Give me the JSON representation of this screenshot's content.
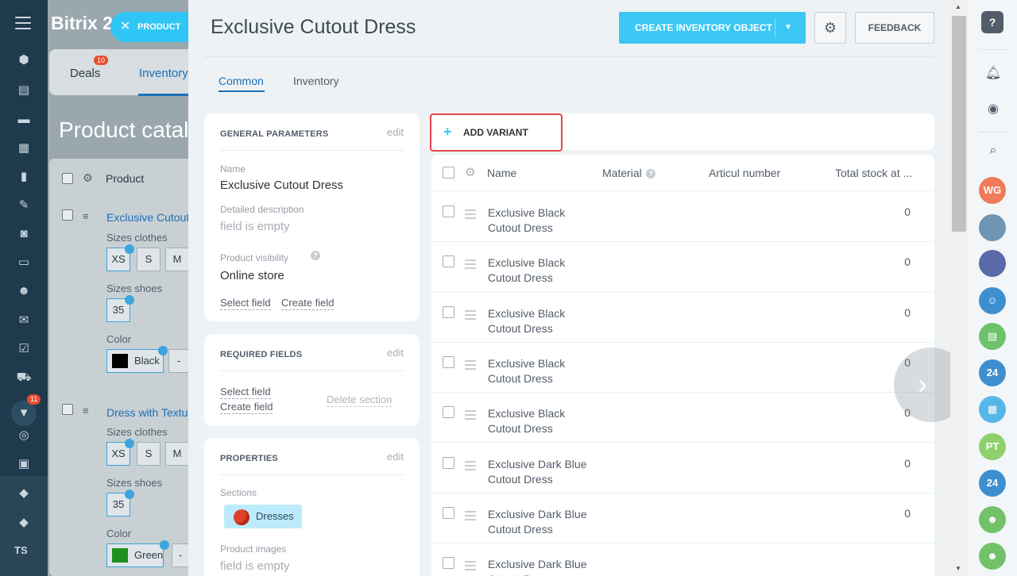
{
  "background": {
    "logo": "Bitrix 2",
    "tabs": [
      {
        "label": "Deals",
        "badge": "10"
      },
      {
        "label": "Inventory"
      }
    ],
    "page_title": "Product catalog",
    "table_header": "Product",
    "products": [
      {
        "name": "Exclusive Cutout",
        "sizes_clothes_label": "Sizes clothes",
        "sizes_clothes": [
          "XS",
          "S",
          "M"
        ],
        "sizes_shoes_label": "Sizes shoes",
        "sizes_shoes": [
          "35"
        ],
        "color_label": "Color",
        "color": "Black",
        "color_swatch": "#000000"
      },
      {
        "name": "Dress with Textur",
        "sizes_clothes_label": "Sizes clothes",
        "sizes_clothes": [
          "XS",
          "S",
          "M"
        ],
        "sizes_shoes_label": "Sizes shoes",
        "sizes_shoes": [
          "35"
        ],
        "color_label": "Color",
        "color": "Green",
        "color_swatch": "#1f8f1f"
      }
    ],
    "more_chip": "-"
  },
  "leftnav": {
    "badge": "11",
    "user_initials": "TS"
  },
  "product_pill": {
    "close": "✕",
    "label": "PRODUCT"
  },
  "panel": {
    "title": "Exclusive Cutout Dress",
    "create_button": "CREATE INVENTORY OBJECT",
    "feedback_button": "FEEDBACK",
    "tabs": [
      {
        "label": "Common"
      },
      {
        "label": "Inventory"
      }
    ],
    "general": {
      "heading": "GENERAL PARAMETERS",
      "edit": "edit",
      "name_label": "Name",
      "name_value": "Exclusive Cutout Dress",
      "desc_label": "Detailed description",
      "desc_value": "field is empty",
      "visibility_label": "Product visibility",
      "visibility_value": "Online store",
      "select_field": "Select field",
      "create_field": "Create field"
    },
    "required": {
      "heading": "REQUIRED FIELDS",
      "edit": "edit",
      "select_field": "Select field",
      "create_field": "Create field",
      "delete_section": "Delete section"
    },
    "properties": {
      "heading": "PROPERTIES",
      "edit": "edit",
      "sections_label": "Sections",
      "section_value": "Dresses",
      "images_label": "Product images",
      "images_value": "field is empty"
    },
    "add_variant": "ADD VARIANT",
    "grid": {
      "columns": [
        "Name",
        "Material",
        "Articul number",
        "Total stock at ..."
      ],
      "rows": [
        {
          "name": "Exclusive Black Cutout Dress",
          "stock": "0"
        },
        {
          "name": "Exclusive Black Cutout Dress",
          "stock": "0"
        },
        {
          "name": "Exclusive Black Cutout Dress",
          "stock": "0"
        },
        {
          "name": "Exclusive Black Cutout Dress",
          "stock": "0"
        },
        {
          "name": "Exclusive Black Cutout Dress",
          "stock": "0"
        },
        {
          "name": "Exclusive Dark Blue Cutout Dress",
          "stock": "0"
        },
        {
          "name": "Exclusive Dark Blue Cutout Dress",
          "stock": "0"
        },
        {
          "name": "Exclusive Dark Blue Cutout Dress",
          "stock": ""
        }
      ]
    }
  },
  "rightbar": {
    "help": "?",
    "avatars": [
      {
        "initials": "WG",
        "color": "#f07b5a"
      },
      {
        "initials": "",
        "color": "#6f95b5"
      },
      {
        "initials": "",
        "color": "#5a6aa8"
      },
      {
        "initials": "",
        "color": "#3e8fd0"
      },
      {
        "initials": "",
        "color": "#6cc36a"
      },
      {
        "initials": "24",
        "color": "#3e8fd0"
      },
      {
        "initials": "",
        "color": "#55b7e8"
      },
      {
        "initials": "PT",
        "color": "#8fd06d"
      },
      {
        "initials": "24",
        "color": "#3e8fd0"
      },
      {
        "initials": "",
        "color": "#73c26a"
      },
      {
        "initials": "",
        "color": "#73c26a"
      }
    ]
  },
  "colors": {
    "accent": "#3bc8f5",
    "link": "#1c6fb8",
    "highlight": "#e8434b"
  }
}
